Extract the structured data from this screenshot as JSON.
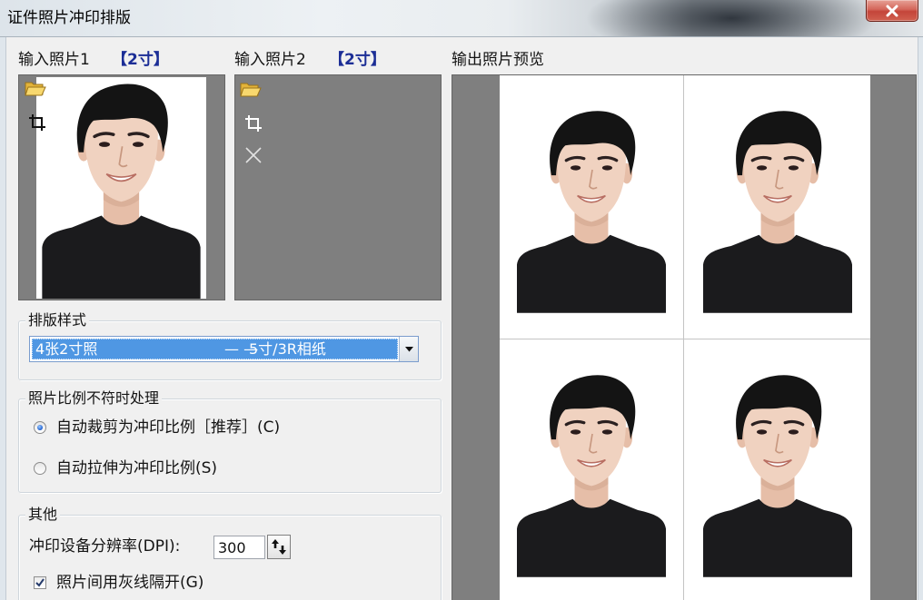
{
  "window": {
    "title": "证件照片冲印排版",
    "close_icon": "close-icon"
  },
  "input1": {
    "label": "输入照片1",
    "size": "【2寸】",
    "tools": [
      "folder-open-icon",
      "crop-icon"
    ]
  },
  "input2": {
    "label": "输入照片2",
    "size": "【2寸】",
    "tools": [
      "folder-open-icon",
      "crop-icon",
      "delete-icon"
    ]
  },
  "output": {
    "label": "输出照片预览"
  },
  "layout_style": {
    "legend": "排版样式",
    "selected": {
      "name": "4张2寸照",
      "separator": "— —",
      "paper": "5寸/3R相纸"
    }
  },
  "ratio_handling": {
    "legend": "照片比例不符时处理",
    "options": [
      {
        "label": "自动裁剪为冲印比例［推荐］(C)",
        "checked": true
      },
      {
        "label": "自动拉伸为冲印比例(S)",
        "checked": false
      }
    ]
  },
  "other": {
    "legend": "其他",
    "dpi_label": "冲印设备分辨率(DPI):",
    "dpi_value": "300",
    "gray_line": {
      "label": "照片间用灰线隔开(G)",
      "checked": true
    }
  },
  "colors": {
    "size_accent": "#1c2e96",
    "selection": "#4f97e3",
    "photo_frame": "#7f7f7f",
    "close_button": "#c4453a"
  }
}
